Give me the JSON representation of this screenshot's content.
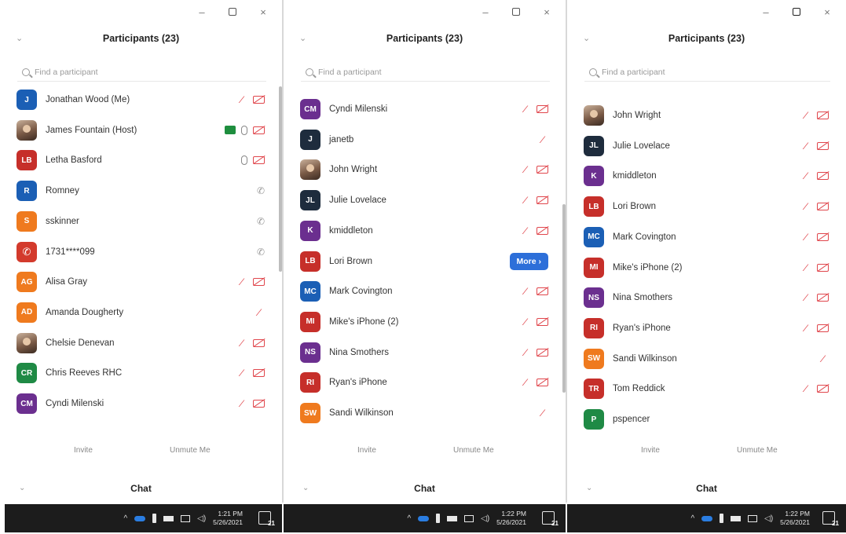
{
  "window_controls": {
    "minimize": "–",
    "close": "×"
  },
  "panels": [
    {
      "title": "Participants (23)",
      "search_placeholder": "Find a participant",
      "invite": "Invite",
      "unmute": "Unmute Me",
      "chat": "Chat",
      "time": "1:21 PM",
      "date": "5/26/2021",
      "notifications": "21",
      "participants": [
        {
          "name": "Jonathan Wood (Me)",
          "initials": "J",
          "color": "#1b5fb5",
          "status": [
            "muted",
            "video-off"
          ]
        },
        {
          "name": "James Fountain (Host)",
          "initials": "",
          "color": "photo",
          "status": [
            "share",
            "mic",
            "video-off"
          ]
        },
        {
          "name": "Letha Basford",
          "initials": "LB",
          "color": "#c62f2a",
          "status": [
            "mic",
            "video-off"
          ]
        },
        {
          "name": "Romney",
          "initials": "R",
          "color": "#1b5fb5",
          "status": [
            "phone"
          ]
        },
        {
          "name": "sskinner",
          "initials": "S",
          "color": "#ef7a1e",
          "status": [
            "phone"
          ]
        },
        {
          "name": "1731****099",
          "initials": "",
          "color": "phone",
          "status": [
            "phone"
          ]
        },
        {
          "name": "Alisa Gray",
          "initials": "AG",
          "color": "#ef7a1e",
          "status": [
            "muted",
            "video-off"
          ]
        },
        {
          "name": "Amanda Dougherty",
          "initials": "AD",
          "color": "#ef7a1e",
          "status": [
            "muted"
          ]
        },
        {
          "name": "Chelsie Denevan",
          "initials": "",
          "color": "photo",
          "status": [
            "muted",
            "video-off"
          ]
        },
        {
          "name": "Chris Reeves RHC",
          "initials": "CR",
          "color": "#1f8a45",
          "status": [
            "muted",
            "video-off"
          ]
        },
        {
          "name": "Cyndi Milenski",
          "initials": "CM",
          "color": "#6b2f8f",
          "status": [
            "muted",
            "video-off"
          ]
        }
      ]
    },
    {
      "title": "Participants (23)",
      "search_placeholder": "Find a participant",
      "invite": "Invite",
      "unmute": "Unmute Me",
      "chat": "Chat",
      "time": "1:22 PM",
      "date": "5/26/2021",
      "notifications": "21",
      "more_label": "More ›",
      "participants": [
        {
          "name": "Cyndi Milenski",
          "initials": "CM",
          "color": "#6b2f8f",
          "status": [
            "muted",
            "video-off"
          ]
        },
        {
          "name": "janetb",
          "initials": "J",
          "color": "#1e2c3d",
          "status": [
            "muted"
          ]
        },
        {
          "name": "John Wright",
          "initials": "",
          "color": "photo",
          "status": [
            "muted",
            "video-off"
          ]
        },
        {
          "name": "Julie Lovelace",
          "initials": "JL",
          "color": "#1e2c3d",
          "status": [
            "muted",
            "video-off"
          ]
        },
        {
          "name": "kmiddleton",
          "initials": "K",
          "color": "#6b2f8f",
          "status": [
            "muted",
            "video-off"
          ]
        },
        {
          "name": "Lori Brown",
          "initials": "LB",
          "color": "#c62f2a",
          "status": [
            "more"
          ]
        },
        {
          "name": "Mark Covington",
          "initials": "MC",
          "color": "#1b5fb5",
          "status": [
            "muted",
            "video-off"
          ]
        },
        {
          "name": "Mike's iPhone (2)",
          "initials": "MI",
          "color": "#c62f2a",
          "status": [
            "muted",
            "video-off"
          ]
        },
        {
          "name": "Nina Smothers",
          "initials": "NS",
          "color": "#6b2f8f",
          "status": [
            "muted",
            "video-off"
          ]
        },
        {
          "name": "Ryan's iPhone",
          "initials": "RI",
          "color": "#c62f2a",
          "status": [
            "muted",
            "video-off"
          ]
        },
        {
          "name": "Sandi Wilkinson",
          "initials": "SW",
          "color": "#ef7a1e",
          "status": [
            "muted"
          ]
        }
      ]
    },
    {
      "title": "Participants (23)",
      "search_placeholder": "Find a participant",
      "invite": "Invite",
      "unmute": "Unmute Me",
      "chat": "Chat",
      "time": "1:22 PM",
      "date": "5/26/2021",
      "notifications": "21",
      "participants": [
        {
          "name": "John Wright",
          "initials": "",
          "color": "photo",
          "status": [
            "muted",
            "video-off"
          ]
        },
        {
          "name": "Julie Lovelace",
          "initials": "JL",
          "color": "#1e2c3d",
          "status": [
            "muted",
            "video-off"
          ]
        },
        {
          "name": "kmiddleton",
          "initials": "K",
          "color": "#6b2f8f",
          "status": [
            "muted",
            "video-off"
          ]
        },
        {
          "name": "Lori Brown",
          "initials": "LB",
          "color": "#c62f2a",
          "status": [
            "muted",
            "video-off"
          ]
        },
        {
          "name": "Mark Covington",
          "initials": "MC",
          "color": "#1b5fb5",
          "status": [
            "muted",
            "video-off"
          ]
        },
        {
          "name": "Mike's iPhone (2)",
          "initials": "MI",
          "color": "#c62f2a",
          "status": [
            "muted",
            "video-off"
          ]
        },
        {
          "name": "Nina Smothers",
          "initials": "NS",
          "color": "#6b2f8f",
          "status": [
            "muted",
            "video-off"
          ]
        },
        {
          "name": "Ryan's iPhone",
          "initials": "RI",
          "color": "#c62f2a",
          "status": [
            "muted",
            "video-off"
          ]
        },
        {
          "name": "Sandi Wilkinson",
          "initials": "SW",
          "color": "#ef7a1e",
          "status": [
            "muted"
          ]
        },
        {
          "name": "Tom Reddick",
          "initials": "TR",
          "color": "#c62f2a",
          "status": [
            "muted",
            "video-off"
          ]
        },
        {
          "name": "pspencer",
          "initials": "P",
          "color": "#1f8a45",
          "status": []
        }
      ]
    }
  ]
}
